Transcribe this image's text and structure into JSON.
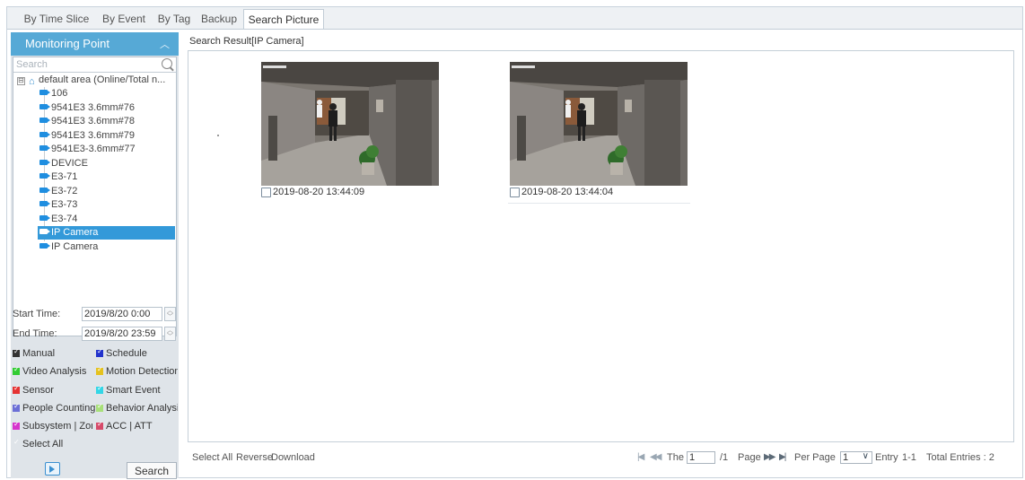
{
  "tabs": [
    {
      "label": "By Time Slice",
      "active": false
    },
    {
      "label": "By Event",
      "active": false
    },
    {
      "label": "By Tag",
      "active": false
    },
    {
      "label": "Backup",
      "active": false
    },
    {
      "label": "Search Picture",
      "active": true
    }
  ],
  "monitoring_point": {
    "title": "Monitoring Point",
    "collapse_icon": "chevron-up-icon",
    "search_placeholder": "Search",
    "root": {
      "label": "default area (Online/Total n...",
      "icon": "home-icon",
      "expander": "⊟"
    },
    "cameras": [
      {
        "label": "106",
        "selected": false
      },
      {
        "label": "9541E3 3.6mm#76",
        "selected": false
      },
      {
        "label": "9541E3 3.6mm#78",
        "selected": false
      },
      {
        "label": "9541E3 3.6mm#79",
        "selected": false
      },
      {
        "label": "9541E3-3.6mm#77",
        "selected": false
      },
      {
        "label": "DEVICE",
        "selected": false
      },
      {
        "label": "E3-71",
        "selected": false
      },
      {
        "label": "E3-72",
        "selected": false
      },
      {
        "label": "E3-73",
        "selected": false
      },
      {
        "label": "E3-74",
        "selected": false
      },
      {
        "label": "IP Camera",
        "selected": true
      },
      {
        "label": "IP Camera",
        "selected": false
      }
    ]
  },
  "time": {
    "start_label": "Start Time:",
    "start_value": "2019/8/20 0:00",
    "end_label": "End Time:",
    "end_value": "2019/8/20 23:59"
  },
  "event_types": [
    [
      {
        "label": "Manual",
        "color": "#333333"
      },
      {
        "label": "Schedule",
        "color": "#2233cc"
      }
    ],
    [
      {
        "label": "Video Analysis",
        "color": "#33cc33"
      },
      {
        "label": "Motion Detection",
        "color": "#e5c21f"
      }
    ],
    [
      {
        "label": "Sensor",
        "color": "#e53333"
      },
      {
        "label": "Smart Event",
        "color": "#33d6e6"
      }
    ],
    [
      {
        "label": "People Counting",
        "color": "#6b6fd6"
      },
      {
        "label": "Behavior Analysis",
        "color": "#a8e07a"
      }
    ],
    [
      {
        "label": "Subsystem | Zone",
        "color": "#d633cc"
      },
      {
        "label": "ACC | ATT",
        "color": "#d64a6a"
      }
    ]
  ],
  "select_all": {
    "label": "Select All"
  },
  "buttons": {
    "search": "Search",
    "picture_icon": "picture-icon"
  },
  "result": {
    "title": "Search Result[IP Camera]",
    "pictures": [
      {
        "timestamp": "2019-08-20 13:44:09",
        "checked": false
      },
      {
        "timestamp": "2019-08-20 13:44:04",
        "checked": false
      }
    ]
  },
  "footer": {
    "select_all": "Select All",
    "reverse": "Reverse",
    "download": "Download",
    "the_label": "The",
    "page_value": "1",
    "total_pages": "/1",
    "page_label": "Page",
    "per_page_label": "Per Page",
    "per_page_value": "1",
    "entry_label": "Entry",
    "entry_range": "1-1",
    "total_entries": "Total Entries : 2"
  }
}
